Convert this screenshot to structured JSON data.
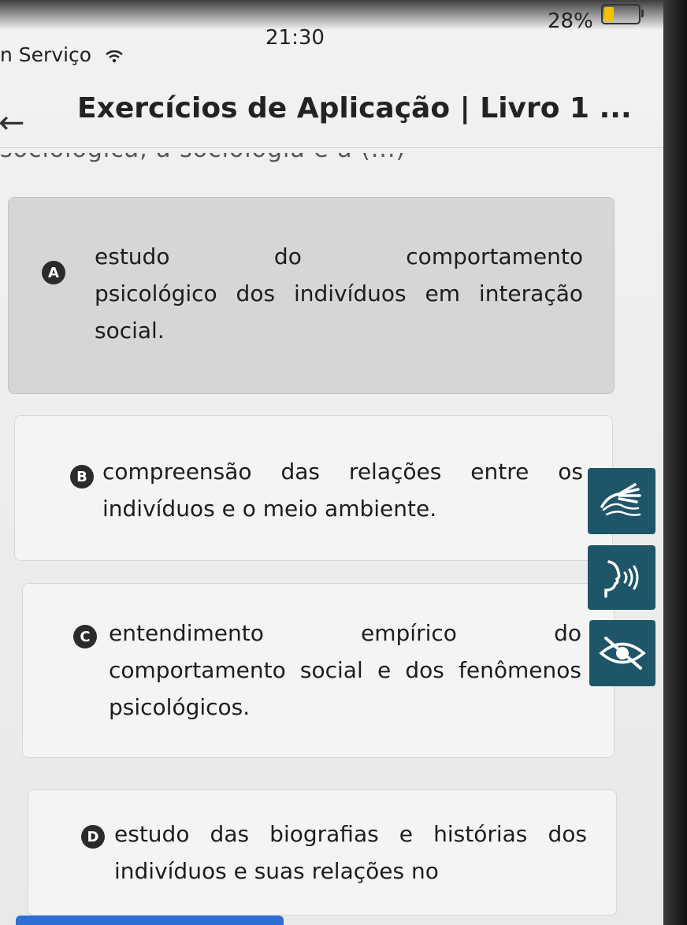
{
  "status_bar": {
    "carrier": "n Serviço",
    "time": "21:30",
    "battery_percent": "28%",
    "battery_level": 0.28,
    "battery_fill_color": "#f2c200"
  },
  "header": {
    "back_icon": "arrow-left-icon",
    "title": "Exercícios de Aplicação | Livro 1 ..."
  },
  "options": [
    {
      "letter": "A",
      "text_first_line": "estudo do comportamento",
      "text_rest": "psicológico dos indivíduos em interação social.",
      "selected": true
    },
    {
      "letter": "B",
      "text": "compreensão das relações entre os indivíduos e o meio ambiente.",
      "selected": false
    },
    {
      "letter": "C",
      "text": "entendimento empírico do comportamento social e dos fenômenos psicológicos.",
      "selected": false
    },
    {
      "letter": "D",
      "text": "estudo das biografias e histórias dos indivíduos e suas relações no",
      "selected": false
    }
  ],
  "accessibility_buttons": [
    {
      "icon": "sign-language-hands-icon"
    },
    {
      "icon": "speaking-head-audio-icon"
    },
    {
      "icon": "low-vision-eye-icon"
    }
  ],
  "colors": {
    "accessibility_button": "#1e5568",
    "selected_card": "#d6d6d6",
    "badge": "#2b2b2b",
    "bottom_bar": "#2d6fd4"
  }
}
